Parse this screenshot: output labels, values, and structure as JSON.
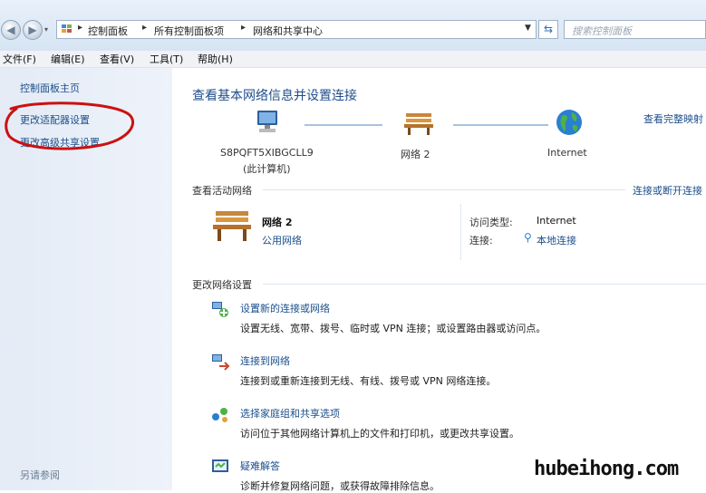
{
  "address_bar": {
    "crumbs": [
      "控制面板",
      "所有控制面板项",
      "网络和共享中心"
    ],
    "search_placeholder": "搜索控制面板"
  },
  "menu": [
    "文件(F)",
    "编辑(E)",
    "查看(V)",
    "工具(T)",
    "帮助(H)"
  ],
  "sidebar": {
    "links": [
      "控制面板主页",
      "更改适配器设置",
      "更改高级共享设置"
    ],
    "see_also": "另请参阅",
    "highlight_color": "#cc1111"
  },
  "main": {
    "title": "查看基本网络信息并设置连接",
    "view_full_map": "查看完整映射",
    "map": {
      "computer_name": "S8PQFT5XIBGCLL9",
      "computer_sub": "(此计算机)",
      "network_name": "网络 2",
      "internet": "Internet"
    },
    "active_networks_header": "查看活动网络",
    "connect_disconnect": "连接或断开连接",
    "active": {
      "name": "网络 2",
      "type": "公用网络",
      "access_type_label": "访问类型:",
      "access_type_value": "Internet",
      "connections_label": "连接:",
      "connection_value": "本地连接"
    },
    "change_settings_header": "更改网络设置",
    "tasks": [
      {
        "icon": "new-connection-icon",
        "title": "设置新的连接或网络",
        "desc": "设置无线、宽带、拨号、临时或 VPN 连接；或设置路由器或访问点。"
      },
      {
        "icon": "connect-network-icon",
        "title": "连接到网络",
        "desc": "连接到或重新连接到无线、有线、拨号或 VPN 网络连接。"
      },
      {
        "icon": "homegroup-sharing-icon",
        "title": "选择家庭组和共享选项",
        "desc": "访问位于其他网络计算机上的文件和打印机，或更改共享设置。"
      },
      {
        "icon": "troubleshoot-icon",
        "title": "疑难解答",
        "desc": "诊断并修复网络问题，或获得故障排除信息。"
      }
    ]
  },
  "watermark": "hubeihong.com"
}
